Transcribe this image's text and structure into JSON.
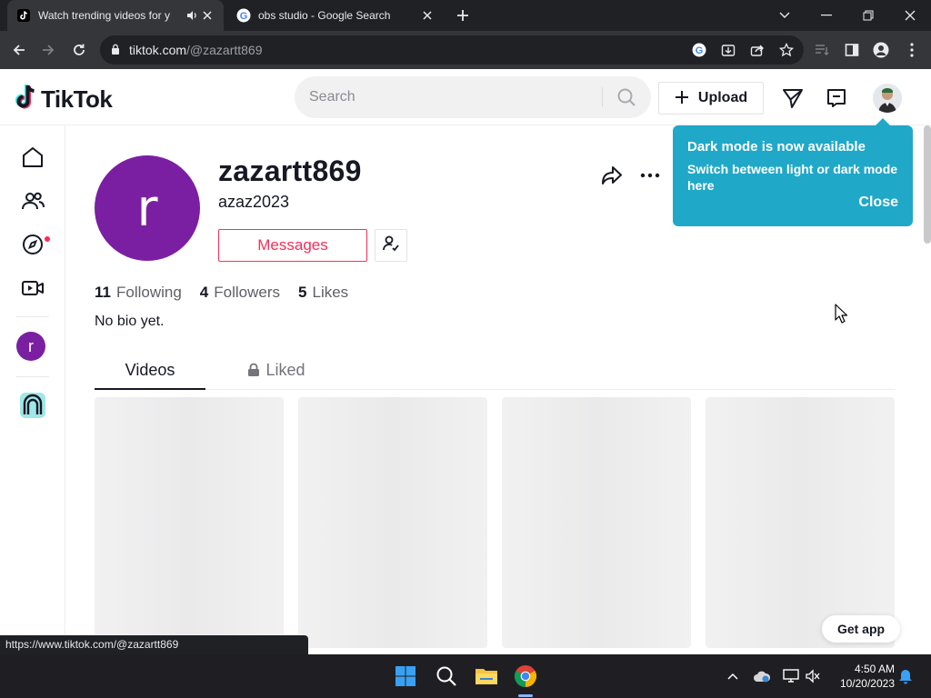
{
  "browser": {
    "tabs": [
      {
        "title": "Watch trending videos for y",
        "active": true
      },
      {
        "title": "obs studio - Google Search",
        "active": false
      }
    ],
    "url_host": "tiktok.com",
    "url_path": "/@zazartt869",
    "status_url": "https://www.tiktok.com/@zazartt869"
  },
  "header": {
    "logo_text": "TikTok",
    "search_placeholder": "Search",
    "upload_label": "Upload"
  },
  "profile": {
    "avatar_letter": "r",
    "username": "zazartt869",
    "nickname": "azaz2023",
    "messages_label": "Messages",
    "stats": {
      "following_count": "11",
      "following_label": "Following",
      "followers_count": "4",
      "followers_label": "Followers",
      "likes_count": "5",
      "likes_label": "Likes"
    },
    "bio": "No bio yet.",
    "tabs": {
      "videos": "Videos",
      "liked": "Liked"
    }
  },
  "sidebar": {
    "avatar_letter": "r"
  },
  "tooltip": {
    "title": "Dark mode is now available",
    "body": "Switch between light or dark mode here",
    "close_label": "Close"
  },
  "get_app_label": "Get app",
  "taskbar": {
    "time": "4:50 AM",
    "date": "10/20/2023"
  },
  "colors": {
    "accent": "#fe2c55",
    "avatar": "#7b1fa2",
    "tooltip": "#20a8c9"
  }
}
